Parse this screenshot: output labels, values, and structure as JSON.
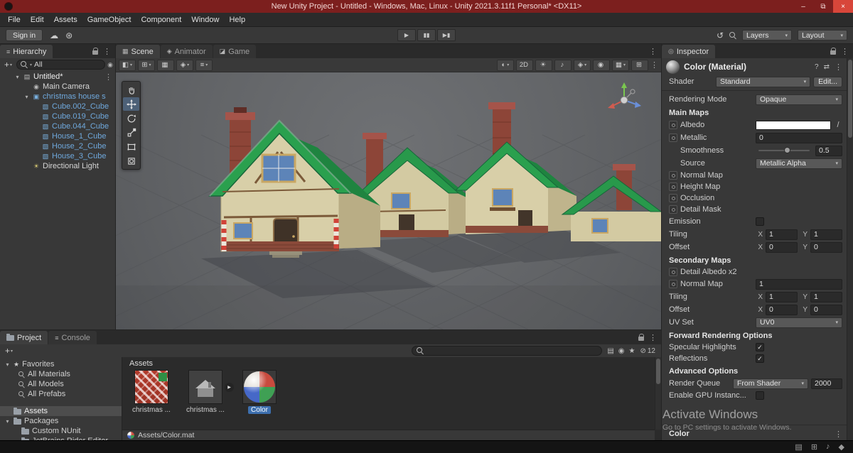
{
  "title_bar": {
    "title": "New Unity Project - Untitled - Windows, Mac, Linux - Unity 2021.3.11f1 Personal* <DX11>",
    "minimize": "–",
    "maximize": "⧉",
    "close": "×"
  },
  "menu": {
    "items": [
      {
        "label": "File"
      },
      {
        "label": "Edit"
      },
      {
        "label": "Assets"
      },
      {
        "label": "GameObject"
      },
      {
        "label": "Component"
      },
      {
        "label": "Window"
      },
      {
        "label": "Help"
      }
    ]
  },
  "toolbar": {
    "sign_in": "Sign in",
    "cloud_icon": "☁",
    "services_icon": "⊛",
    "play_icon": "▶",
    "pause_icon": "▮▮",
    "step_icon": "▶▮",
    "history_icon": "↺",
    "layers": "Layers",
    "layout": "Layout"
  },
  "hierarchy": {
    "tab": "Hierarchy",
    "search_value": "All",
    "items": [
      {
        "label": "Untitled*",
        "pad": 20,
        "arrow": "▾",
        "glyph": "▤",
        "cls": "root"
      },
      {
        "label": "Main Camera",
        "pad": 33,
        "arrow": "",
        "glyph": "◉",
        "cls": ""
      },
      {
        "label": "christmas house s",
        "pad": 33,
        "arrow": "▾",
        "glyph": "▣",
        "cls": "prefab"
      },
      {
        "label": "Cube.002_Cube",
        "pad": 46,
        "arrow": "",
        "glyph": "▧",
        "cls": "prefab"
      },
      {
        "label": "Cube.019_Cube",
        "pad": 46,
        "arrow": "",
        "glyph": "▧",
        "cls": "prefab"
      },
      {
        "label": "Cube.044_Cube",
        "pad": 46,
        "arrow": "",
        "glyph": "▧",
        "cls": "prefab"
      },
      {
        "label": "House_1_Cube",
        "pad": 46,
        "arrow": "",
        "glyph": "▧",
        "cls": "prefab"
      },
      {
        "label": "House_2_Cube",
        "pad": 46,
        "arrow": "",
        "glyph": "▧",
        "cls": "prefab"
      },
      {
        "label": "House_3_Cube",
        "pad": 46,
        "arrow": "",
        "glyph": "▧",
        "cls": "prefab"
      },
      {
        "label": "Directional Light",
        "pad": 33,
        "arrow": "",
        "glyph": "☀",
        "cls": "light"
      }
    ]
  },
  "scene": {
    "tabs": [
      {
        "glyph": "▦",
        "label": "Scene",
        "cls": "active"
      },
      {
        "glyph": "◈",
        "label": "Animator",
        "cls": ""
      },
      {
        "glyph": "◪",
        "label": "Game",
        "cls": ""
      }
    ],
    "tb_left": [
      {
        "glyph": "◧",
        "caret": "▾"
      },
      {
        "glyph": "⊞",
        "caret": "▾"
      },
      {
        "glyph": "▦",
        "caret": ""
      },
      {
        "glyph": "◈",
        "caret": "▾"
      },
      {
        "glyph": "≡",
        "caret": "▾"
      }
    ],
    "tb_right": [
      {
        "glyph": "◐",
        "caret": "▾"
      },
      {
        "glyph": "2D",
        "caret": ""
      },
      {
        "glyph": "☀",
        "caret": ""
      },
      {
        "glyph": "♪",
        "caret": ""
      },
      {
        "glyph": "◈",
        "caret": "▾"
      },
      {
        "glyph": "◉",
        "caret": ""
      },
      {
        "glyph": "▦",
        "caret": "▾"
      },
      {
        "glyph": "⊞",
        "caret": ""
      }
    ]
  },
  "inspector": {
    "tab": "Inspector",
    "material_name": "Color (Material)",
    "help_icon": "?",
    "presets_icon": "⇄",
    "shader": {
      "label": "Shader",
      "value": "Standard",
      "edit": "Edit..."
    },
    "rendering_mode": {
      "label": "Rendering Mode",
      "value": "Opaque"
    },
    "sections": {
      "main": "Main Maps",
      "secondary": "Secondary Maps",
      "forward": "Forward Rendering Options",
      "advanced": "Advanced Options"
    },
    "albedo_label": "Albedo",
    "metallic": {
      "label": "Metallic",
      "value": "0"
    },
    "smoothness": {
      "label": "Smoothness",
      "value": "0.5"
    },
    "source": {
      "label": "Source",
      "value": "Metallic Alpha"
    },
    "normal_map_label": "Normal Map",
    "height_map_label": "Height Map",
    "occlusion_label": "Occlusion",
    "detail_mask_label": "Detail Mask",
    "emission_label": "Emission",
    "tiling1": {
      "label": "Tiling",
      "x": "X",
      "xv": "1",
      "y": "Y",
      "yv": "1"
    },
    "offset1": {
      "label": "Offset",
      "x": "X",
      "xv": "0",
      "y": "Y",
      "yv": "0"
    },
    "detail_albedo_label": "Detail Albedo x2",
    "normal_map2": {
      "label": "Normal Map",
      "value": "1"
    },
    "tiling2": {
      "label": "Tiling",
      "x": "X",
      "xv": "1",
      "y": "Y",
      "yv": "1"
    },
    "offset2": {
      "label": "Offset",
      "x": "X",
      "xv": "0",
      "y": "Y",
      "yv": "0"
    },
    "uv_set": {
      "label": "UV Set",
      "value": "UV0"
    },
    "specular_label": "Specular Highlights",
    "reflections_label": "Reflections",
    "check": "✓",
    "render_queue": {
      "label": "Render Queue",
      "value": "From Shader",
      "number": "2000"
    },
    "gpu_label": "Enable GPU Instanc...",
    "preview_label": "Color"
  },
  "project": {
    "tab_project": "Project",
    "tab_console": "Console",
    "favorites_label": "Favorites",
    "favorite_items": [
      {
        "label": "All Materials"
      },
      {
        "label": "All Models"
      },
      {
        "label": "All Prefabs"
      }
    ],
    "assets_label": "Assets",
    "packages_label": "Packages",
    "package_items": [
      {
        "label": "Custom NUnit"
      },
      {
        "label": "JetBrains Rider Editor"
      }
    ],
    "ptool_icons": [
      {
        "glyph": "▤"
      },
      {
        "glyph": "◉"
      },
      {
        "glyph": "★"
      }
    ],
    "hidden_icon": "⊘",
    "hidden_count": "12",
    "location_label": "Assets",
    "thumb_tex": "christmas ...",
    "thumb_model": "christmas ...",
    "thumb_mat": "Color",
    "footer": "Assets/Color.mat"
  },
  "watermark": {
    "line1": "Activate Windows",
    "line2": "Go to PC settings to activate Windows."
  },
  "status": {
    "icons": [
      {
        "glyph": "▤"
      },
      {
        "glyph": "⊞"
      },
      {
        "glyph": "♪"
      },
      {
        "glyph": "◆"
      }
    ]
  }
}
